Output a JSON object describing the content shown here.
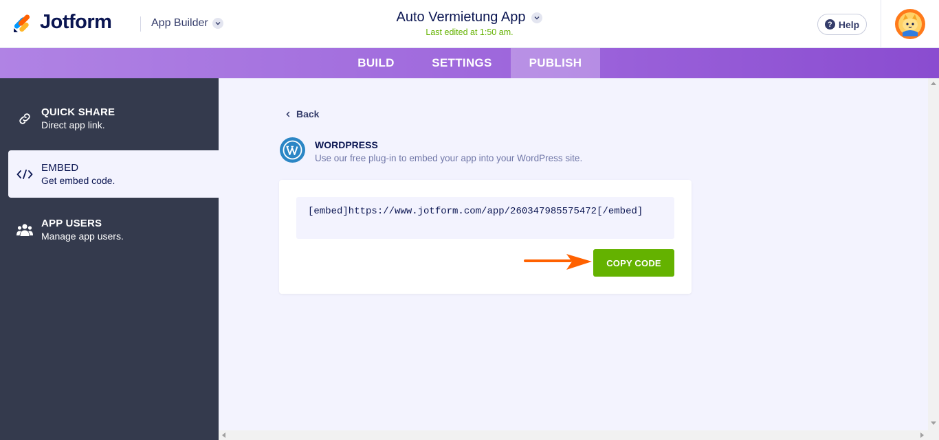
{
  "header": {
    "logo_text": "Jotform",
    "app_builder_label": "App Builder",
    "app_title": "Auto Vermietung App",
    "last_edited": "Last edited at 1:50 am.",
    "help_label": "Help"
  },
  "tabs": [
    {
      "label": "BUILD",
      "active": false
    },
    {
      "label": "SETTINGS",
      "active": false
    },
    {
      "label": "PUBLISH",
      "active": true
    }
  ],
  "sidebar": {
    "items": [
      {
        "title": "QUICK SHARE",
        "subtitle": "Direct app link.",
        "icon": "link-icon",
        "active": false
      },
      {
        "title": "EMBED",
        "subtitle": "Get embed code.",
        "icon": "code-icon",
        "active": true
      },
      {
        "title": "APP USERS",
        "subtitle": "Manage app users.",
        "icon": "users-icon",
        "active": false
      }
    ]
  },
  "main": {
    "back_label": "Back",
    "section_title": "WORDPRESS",
    "section_description": "Use our free plug-in to embed your app into your WordPress site.",
    "embed_code": "[embed]https://www.jotform.com/app/260347985575472[/embed]",
    "copy_button_label": "COPY CODE"
  },
  "colors": {
    "accent_green": "#64b200",
    "tab_gradient_start": "#b083e4",
    "tab_gradient_end": "#8a4cd0",
    "sidebar_bg": "#343a4d",
    "arrow_orange": "#ff6100"
  }
}
